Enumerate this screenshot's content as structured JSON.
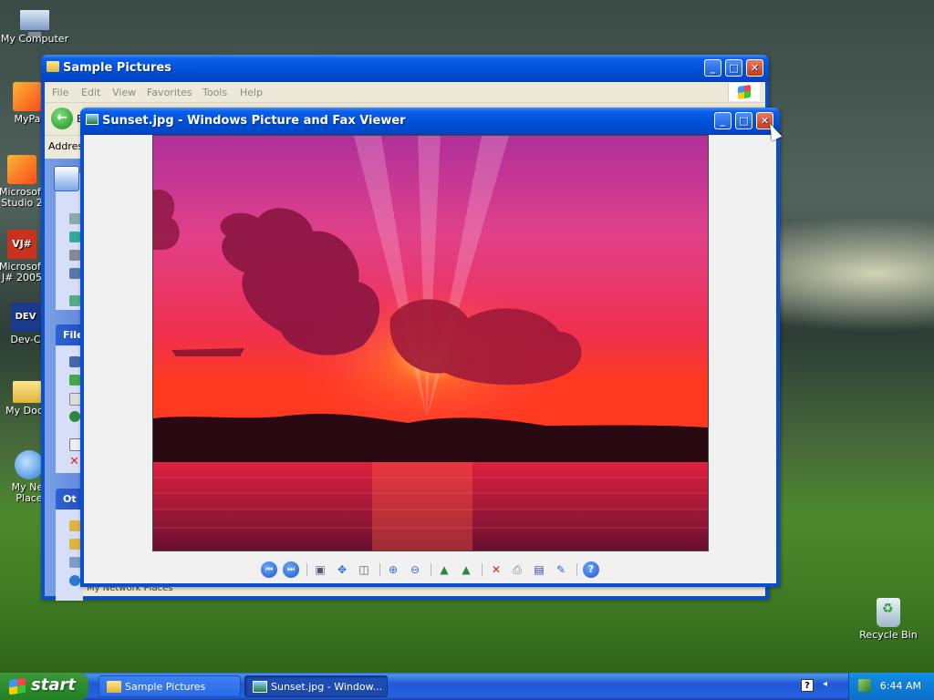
{
  "desktop": {
    "icons": [
      {
        "label": "My Computer"
      },
      {
        "label": "MyPa"
      },
      {
        "label_line1": "Microsoft",
        "label_line2": "Studio 2"
      },
      {
        "badge": "VJ#",
        "label_line1": "Microsoft",
        "label_line2": "J# 2005"
      },
      {
        "badge": "DEV",
        "label": "Dev-C"
      },
      {
        "label": "My Docu"
      },
      {
        "label_line1": "My Net",
        "label_line2": "Place"
      },
      {
        "label": "Recycle Bin"
      }
    ]
  },
  "explorer": {
    "title": "Sample Pictures",
    "menu": [
      "File",
      "Edit",
      "View",
      "Favorites",
      "Tools",
      "Help"
    ],
    "address_label": "Addres",
    "back_label": "B",
    "taskpane": {
      "file_head": "File",
      "other_head": "Ot"
    },
    "status_text": "My Network Places"
  },
  "viewer": {
    "title": "Sunset.jpg - Windows Picture and Fax Viewer",
    "image_subject": "sunset over water",
    "toolbar_icons": [
      "previous-image-icon",
      "next-image-icon",
      "best-fit-icon",
      "actual-size-icon",
      "slideshow-icon",
      "zoom-in-icon",
      "zoom-out-icon",
      "rotate-clockwise-icon",
      "rotate-counterclockwise-icon",
      "delete-icon",
      "print-icon",
      "save-icon",
      "edit-icon",
      "help-icon"
    ]
  },
  "taskbar": {
    "start_label": "start",
    "tasks": [
      {
        "label": "Sample Pictures",
        "active": false
      },
      {
        "label": "Sunset.jpg - Window...",
        "active": true
      }
    ],
    "clock": "6:44 AM",
    "help_icon_text": "?"
  },
  "colors": {
    "title_blue": "#0052dc",
    "start_green": "#2f8f2f",
    "close_red": "#c8391a"
  }
}
